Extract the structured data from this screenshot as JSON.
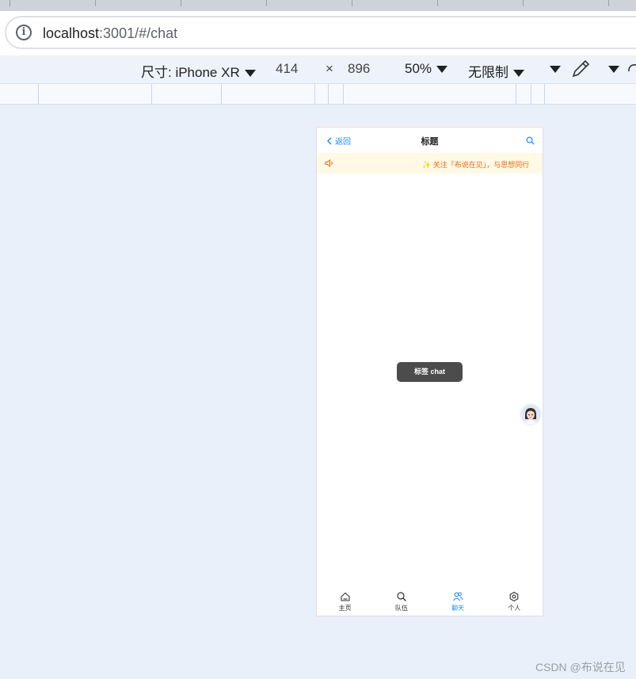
{
  "browser": {
    "url_host": "localhost",
    "url_rest": ":3001/#/chat"
  },
  "devtools": {
    "size_label": "尺寸: iPhone XR",
    "width": "414",
    "times": "×",
    "height": "896",
    "zoom": "50%",
    "throttle": "无限制"
  },
  "app": {
    "nav": {
      "back_label": "返回",
      "title": "标题"
    },
    "notice": {
      "text": "关注「布说在见」，与思想同行"
    },
    "toast": "标签 chat",
    "tabbar": [
      {
        "label": "主页",
        "icon": "home-icon",
        "active": false
      },
      {
        "label": "队伍",
        "icon": "search-icon",
        "active": false
      },
      {
        "label": "聊天",
        "icon": "users-icon",
        "active": true
      },
      {
        "label": "个人",
        "icon": "gear-icon",
        "active": false
      }
    ],
    "colors": {
      "primary": "#1989fa",
      "notice_bg": "#fff9e6",
      "notice_text": "#ed6a0c",
      "toast_bg": "#4c4c4c"
    }
  },
  "watermark": "CSDN @布说在见"
}
